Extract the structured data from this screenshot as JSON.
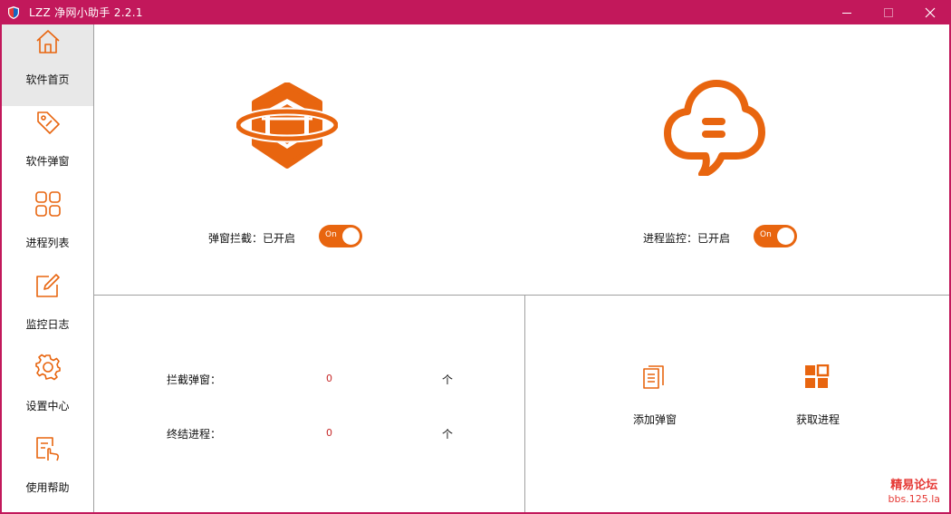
{
  "window": {
    "title": "LZZ 净网小助手 2.2.1",
    "accent": "#c2185b",
    "orange": "#e8650f",
    "minimize_glyph": "—",
    "maximize_glyph": "☐",
    "close_glyph": "✕"
  },
  "sidebar": {
    "items": [
      {
        "label": "软件首页",
        "icon": "home-icon",
        "active": true
      },
      {
        "label": "软件弹窗",
        "icon": "tag-icon",
        "active": false
      },
      {
        "label": "进程列表",
        "icon": "grid-icon",
        "active": false
      },
      {
        "label": "监控日志",
        "icon": "edit-icon",
        "active": false
      },
      {
        "label": "设置中心",
        "icon": "gear-icon",
        "active": false
      },
      {
        "label": "使用帮助",
        "icon": "help-document-icon",
        "active": false
      }
    ]
  },
  "main": {
    "popup_block": {
      "label": "弹窗拦截：已开启",
      "toggle_text": "On",
      "enabled": true
    },
    "process_monitor": {
      "label": "进程监控：已开启",
      "toggle_text": "On",
      "enabled": true
    },
    "stats": [
      {
        "label": "拦截弹窗：",
        "value": "0",
        "unit": "个"
      },
      {
        "label": "终结进程：",
        "value": "0",
        "unit": "个"
      }
    ],
    "actions": [
      {
        "label": "添加弹窗",
        "icon": "documents-icon"
      },
      {
        "label": "获取进程",
        "icon": "squares-grid-icon"
      }
    ]
  },
  "watermark": {
    "line1": "精易论坛",
    "line2": "bbs.125.la"
  }
}
